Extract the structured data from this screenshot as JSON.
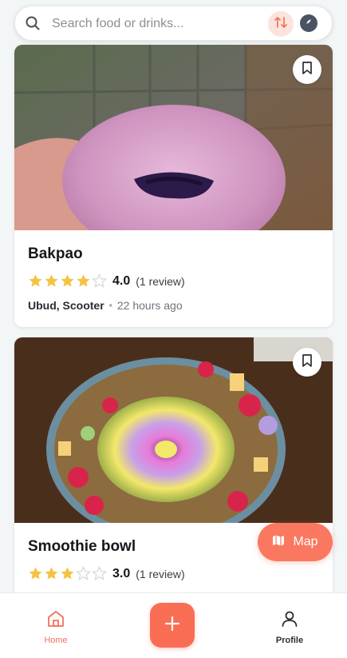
{
  "search": {
    "placeholder": "Search food or drinks..."
  },
  "posts": [
    {
      "title": "Bakpao",
      "rating": 4,
      "rating_label": "4.0",
      "reviews": "(1 review)",
      "location": "Ubud, Scooter",
      "separator": "•",
      "time": "22 hours ago"
    },
    {
      "title": "Smoothie bowl",
      "rating": 3,
      "rating_label": "3.0",
      "reviews": "(1 review)"
    }
  ],
  "map_button": {
    "label": "Map"
  },
  "nav": {
    "home_label": "Home",
    "profile_label": "Profile"
  },
  "colors": {
    "accent": "#fa7860",
    "star_filled": "#f5c242",
    "star_empty": "#d9d9d9"
  },
  "icons": [
    "search-icon",
    "sort-icon",
    "compass-icon",
    "bookmark-icon",
    "star-icon",
    "map-icon",
    "home-icon",
    "plus-icon",
    "user-icon"
  ]
}
